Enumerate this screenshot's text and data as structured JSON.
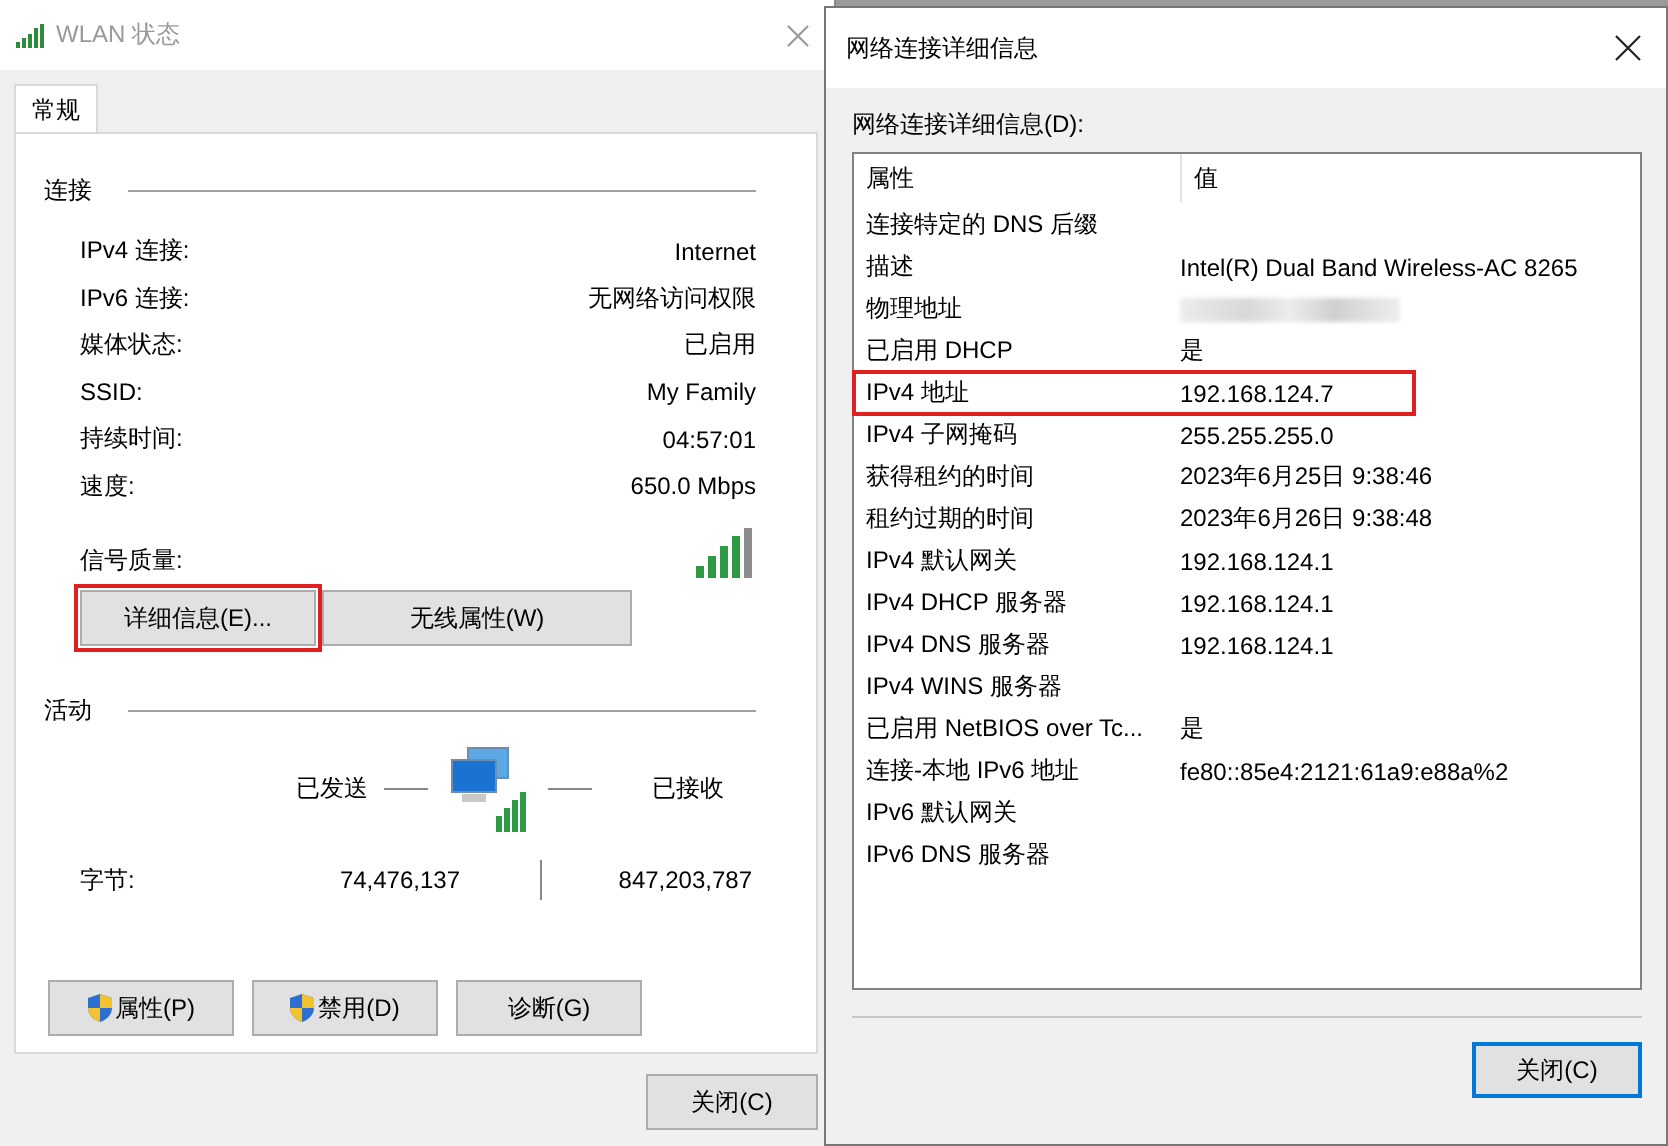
{
  "status_window": {
    "title": "WLAN 状态",
    "active": false,
    "tabs": [
      {
        "label": "常规",
        "selected": true
      }
    ],
    "connection": {
      "heading": "连接",
      "rows": [
        {
          "label": "IPv4 连接:",
          "value": "Internet"
        },
        {
          "label": "IPv6 连接:",
          "value": "无网络访问权限"
        },
        {
          "label": "媒体状态:",
          "value": "已启用"
        },
        {
          "label": "SSID:",
          "value": "My Family"
        },
        {
          "label": "持续时间:",
          "value": "04:57:01"
        },
        {
          "label": "速度:",
          "value": "650.0 Mbps"
        }
      ],
      "signal_label": "信号质量:",
      "buttons": [
        {
          "label": "详细信息(E)...",
          "highlighted": true
        },
        {
          "label": "无线属性(W)",
          "highlighted": false
        }
      ]
    },
    "activity": {
      "heading": "活动",
      "sent_label": "已发送",
      "received_label": "已接收",
      "bytes_label": "字节:",
      "sent": "74,476,137",
      "received": "847,203,787"
    },
    "buttons": [
      {
        "label": "属性(P)",
        "shield": true
      },
      {
        "label": "禁用(D)",
        "shield": true
      },
      {
        "label": "诊断(G)",
        "shield": false
      }
    ],
    "close_button": "关闭(C)"
  },
  "details_window": {
    "title": "网络连接详细信息",
    "active": true,
    "list_label": "网络连接详细信息(D):",
    "columns": [
      "属性",
      "值"
    ],
    "rows": [
      {
        "property": "连接特定的 DNS 后缀",
        "value": "",
        "redacted": false,
        "highlighted": false
      },
      {
        "property": "描述",
        "value": "Intel(R) Dual Band Wireless-AC 8265",
        "redacted": false,
        "highlighted": false
      },
      {
        "property": "物理地址",
        "value": "",
        "redacted": true,
        "highlighted": false
      },
      {
        "property": "已启用 DHCP",
        "value": "是",
        "redacted": false,
        "highlighted": false
      },
      {
        "property": "IPv4 地址",
        "value": "192.168.124.7",
        "redacted": false,
        "highlighted": true
      },
      {
        "property": "IPv4 子网掩码",
        "value": "255.255.255.0",
        "redacted": false,
        "highlighted": false
      },
      {
        "property": "获得租约的时间",
        "value": "2023年6月25日 9:38:46",
        "redacted": false,
        "highlighted": false
      },
      {
        "property": "租约过期的时间",
        "value": "2023年6月26日 9:38:48",
        "redacted": false,
        "highlighted": false
      },
      {
        "property": "IPv4 默认网关",
        "value": "192.168.124.1",
        "redacted": false,
        "highlighted": false
      },
      {
        "property": "IPv4 DHCP 服务器",
        "value": "192.168.124.1",
        "redacted": false,
        "highlighted": false
      },
      {
        "property": "IPv4 DNS 服务器",
        "value": "192.168.124.1",
        "redacted": false,
        "highlighted": false
      },
      {
        "property": "IPv4 WINS 服务器",
        "value": "",
        "redacted": false,
        "highlighted": false
      },
      {
        "property": "已启用 NetBIOS over Tc...",
        "value": "是",
        "redacted": false,
        "highlighted": false
      },
      {
        "property": "连接-本地 IPv6 地址",
        "value": "fe80::85e4:2121:61a9:e88a%2",
        "redacted": false,
        "highlighted": false
      },
      {
        "property": "IPv6 默认网关",
        "value": "",
        "redacted": false,
        "highlighted": false
      },
      {
        "property": "IPv6 DNS 服务器",
        "value": "",
        "redacted": false,
        "highlighted": false
      }
    ],
    "close_button": "关闭(C)"
  }
}
